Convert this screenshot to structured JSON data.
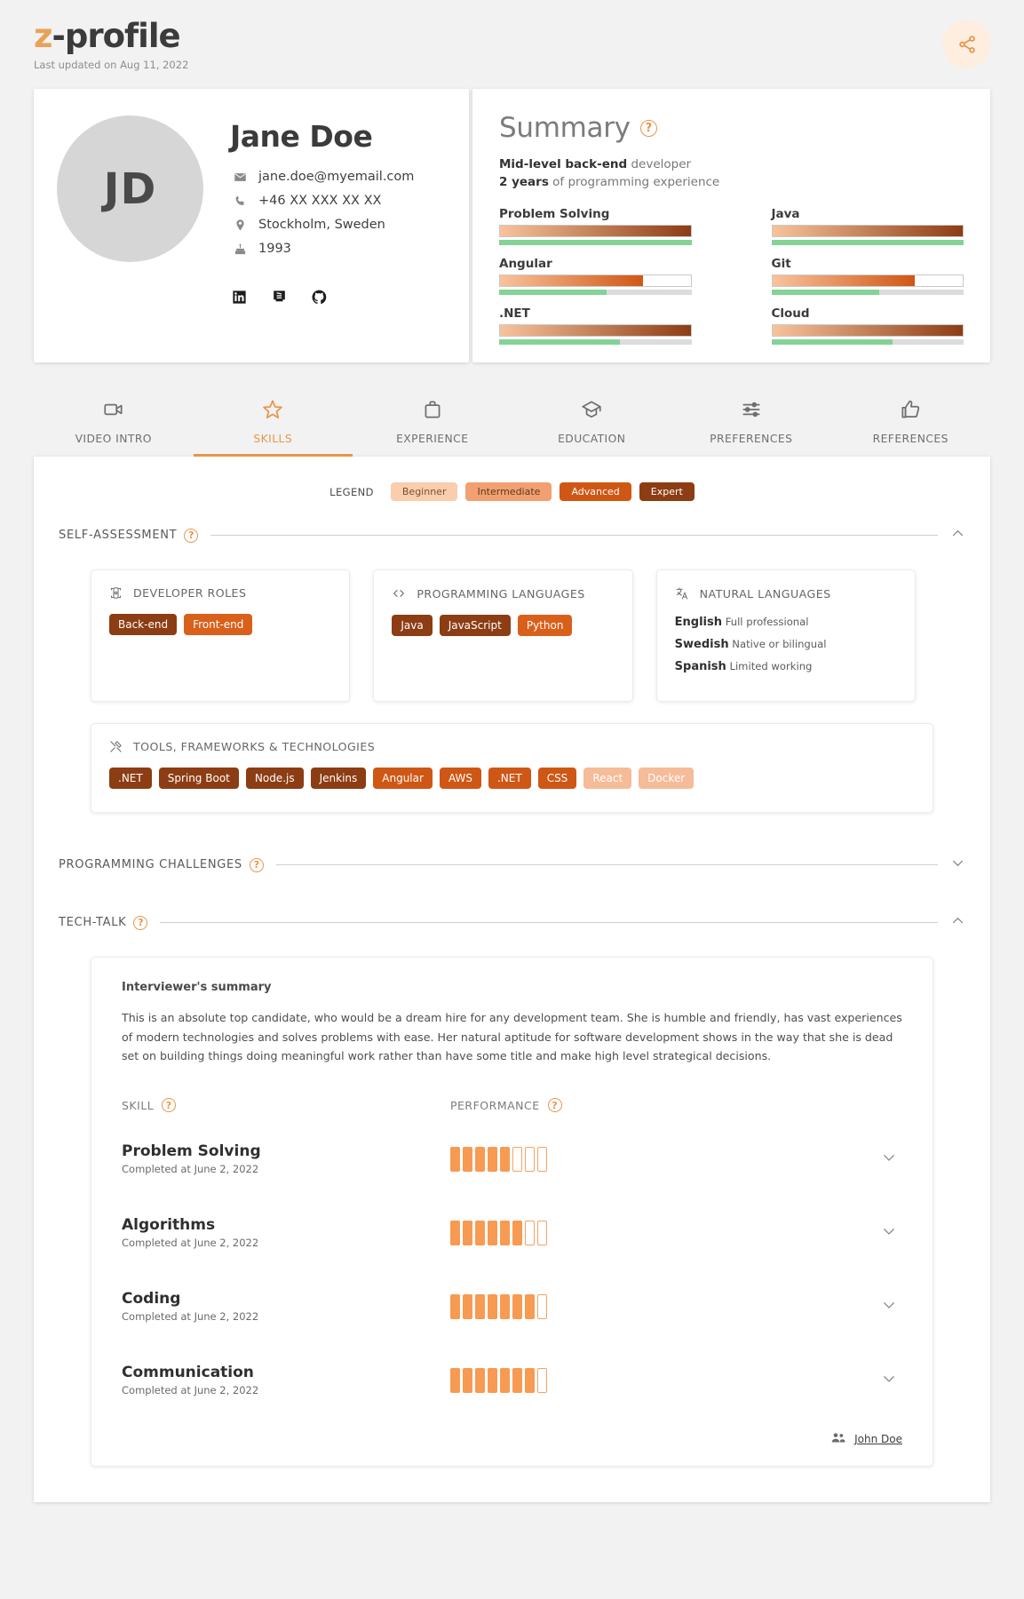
{
  "header": {
    "logo_prefix": "z",
    "logo_rest": "-profile",
    "last_updated": "Last updated on Aug 11, 2022",
    "share_icon": "share-icon"
  },
  "profile": {
    "initials": "JD",
    "name": "Jane Doe",
    "contacts": [
      {
        "icon": "email-icon",
        "value": "jane.doe@myemail.com"
      },
      {
        "icon": "phone-icon",
        "value": "+46 XX XXX XX XX"
      },
      {
        "icon": "location-pin-icon",
        "value": "Stockholm, Sweden"
      },
      {
        "icon": "birthday-cake-icon",
        "value": "1993"
      }
    ],
    "socials": [
      "linkedin-icon",
      "stackoverflow-icon",
      "github-icon"
    ]
  },
  "summary": {
    "title": "Summary",
    "help_icon": "help-icon",
    "role_strong": "Mid-level back-end",
    "role_light": "developer",
    "exp_strong": "2 years",
    "exp_light": "of programming experience",
    "skills": [
      {
        "label": "Problem Solving",
        "level_pct": 100,
        "green_pct": 100,
        "grad_from": "#f8c39c",
        "grad_to": "#8c3d14"
      },
      {
        "label": "Java",
        "level_pct": 100,
        "green_pct": 100,
        "grad_from": "#f8c39c",
        "grad_to": "#8c3d14"
      },
      {
        "label": "Angular",
        "level_pct": 75,
        "green_pct": 56,
        "grad_from": "#f8c39c",
        "grad_to": "#cf5715"
      },
      {
        "label": "Git",
        "level_pct": 75,
        "green_pct": 56,
        "grad_from": "#f8c39c",
        "grad_to": "#cf5715"
      },
      {
        "label": ".NET",
        "level_pct": 100,
        "green_pct": 63,
        "grad_from": "#f8c39c",
        "grad_to": "#8c3d14"
      },
      {
        "label": "Cloud",
        "level_pct": 100,
        "green_pct": 63,
        "grad_from": "#f8c39c",
        "grad_to": "#8c3d14"
      }
    ]
  },
  "tabs": [
    {
      "label": "VIDEO INTRO",
      "icon": "video-camera-icon",
      "active": false
    },
    {
      "label": "SKILLS",
      "icon": "star-icon",
      "active": true
    },
    {
      "label": "EXPERIENCE",
      "icon": "briefcase-icon",
      "active": false
    },
    {
      "label": "EDUCATION",
      "icon": "graduation-cap-icon",
      "active": false
    },
    {
      "label": "PREFERENCES",
      "icon": "sliders-icon",
      "active": false
    },
    {
      "label": "REFERENCES",
      "icon": "thumbs-up-icon",
      "active": false
    }
  ],
  "legend": {
    "label": "LEGEND",
    "items": [
      {
        "label": "Beginner",
        "color": "#f9cdad",
        "text_color": "#7a5136"
      },
      {
        "label": "Intermediate",
        "color": "#f2a071",
        "text_color": "#5d3a21"
      },
      {
        "label": "Advanced",
        "color": "#cf5715",
        "text_color": "#ffffff"
      },
      {
        "label": "Expert",
        "color": "#8c3d14",
        "text_color": "#ffffff"
      }
    ]
  },
  "sections": {
    "self_assessment": {
      "title": "SELF-ASSESSMENT",
      "help_icon": "help-icon",
      "expanded": true,
      "chevron": "chevron-up-icon"
    },
    "programming_challenges": {
      "title": "PROGRAMMING CHALLENGES",
      "help_icon": "help-icon",
      "expanded": false,
      "chevron": "chevron-down-icon"
    },
    "tech_talk": {
      "title": "TECH-TALK",
      "help_icon": "help-icon",
      "expanded": true,
      "chevron": "chevron-up-icon"
    }
  },
  "developer_roles": {
    "title": "DEVELOPER ROLES",
    "icon": "developer-roles-icon",
    "tags": [
      {
        "label": "Back-end",
        "color": "#8c3d14"
      },
      {
        "label": "Front-end",
        "color": "#d9601b"
      }
    ]
  },
  "programming_languages": {
    "title": "PROGRAMMING LANGUAGES",
    "icon": "code-brackets-icon",
    "tags": [
      {
        "label": "Java",
        "color": "#8c3d14"
      },
      {
        "label": "JavaScript",
        "color": "#8c3d14"
      },
      {
        "label": "Python",
        "color": "#d9601b"
      }
    ]
  },
  "natural_languages": {
    "title": "NATURAL LANGUAGES",
    "icon": "translate-icon",
    "items": [
      {
        "name": "English",
        "level": "Full professional"
      },
      {
        "name": "Swedish",
        "level": "Native or bilingual"
      },
      {
        "name": "Spanish",
        "level": "Limited working"
      }
    ]
  },
  "tools": {
    "title": "TOOLS, FRAMEWORKS & TECHNOLOGIES",
    "icon": "tools-icon",
    "tags": [
      {
        "label": ".NET",
        "color": "#8c3d14"
      },
      {
        "label": "Spring Boot",
        "color": "#8c3d14"
      },
      {
        "label": "Node.js",
        "color": "#8c3d14"
      },
      {
        "label": "Jenkins",
        "color": "#8c3d14"
      },
      {
        "label": "Angular",
        "color": "#cf5715"
      },
      {
        "label": "AWS",
        "color": "#cf5715"
      },
      {
        "label": ".NET",
        "color": "#cf5715"
      },
      {
        "label": "CSS",
        "color": "#cf5715"
      },
      {
        "label": "React",
        "color": "#f6bb98"
      },
      {
        "label": "Docker",
        "color": "#f6bb98"
      }
    ]
  },
  "tech_talk": {
    "interviewer_heading": "Interviewer's summary",
    "interviewer_text": "This is an absolute top candidate, who would be a dream hire for any development team. She is humble and friendly, has vast experiences of modern technologies and solves problems with ease. Her natural aptitude for software development shows in the way that she is dead set on building things doing meaningful work rather than have some title and make high level strategical decisions.",
    "col_skill": "SKILL",
    "col_performance": "PERFORMANCE",
    "rows": [
      {
        "skill": "Problem Solving",
        "completed": "Completed at June 2, 2022",
        "score": 5,
        "max": 8,
        "chevron": "chevron-down-icon"
      },
      {
        "skill": "Algorithms",
        "completed": "Completed at June 2, 2022",
        "score": 6,
        "max": 8,
        "chevron": "chevron-down-icon"
      },
      {
        "skill": "Coding",
        "completed": "Completed at June 2, 2022",
        "score": 7,
        "max": 8,
        "chevron": "chevron-down-icon"
      },
      {
        "skill": "Communication",
        "completed": "Completed at June 2, 2022",
        "score": 7,
        "max": 8,
        "chevron": "chevron-down-icon"
      }
    ],
    "reviewer_name": "John Doe",
    "reviewer_icon": "people-icon"
  },
  "colors": {
    "accent": "#e8954a",
    "expert": "#8c3d14",
    "advanced": "#cf5715",
    "intermediate": "#f2a071",
    "beginner": "#f9cdad",
    "green": "#84d396"
  }
}
